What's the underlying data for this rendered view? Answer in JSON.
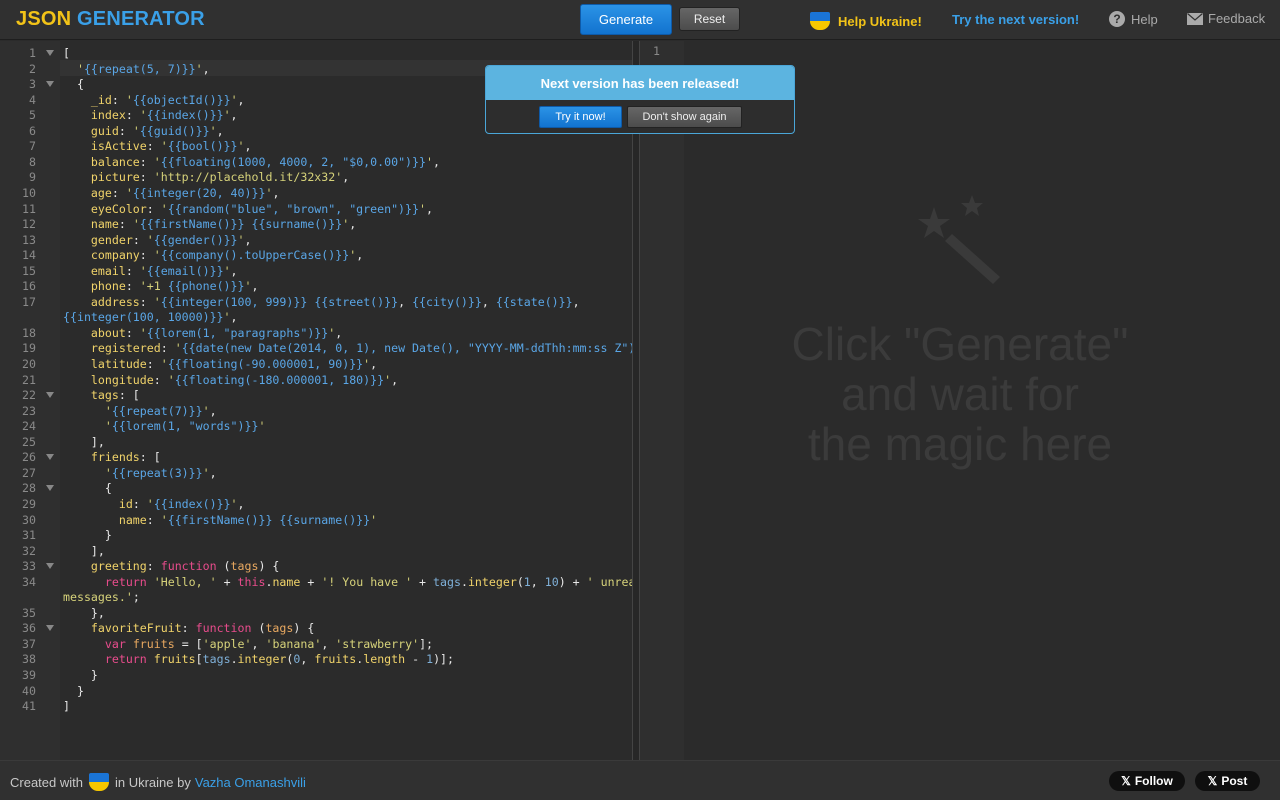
{
  "header": {
    "logo_left": "JSON ",
    "logo_right": "GENERATOR",
    "generate_label": "Generate",
    "reset_label": "Reset",
    "help_ukraine": "Help Ukraine!",
    "next_version": "Try the next version!",
    "help": "Help",
    "feedback": "Feedback"
  },
  "popup": {
    "title": "Next version has been released!",
    "try_label": "Try it now!",
    "dont_show_label": "Don't show again"
  },
  "editor": {
    "lines": [
      {
        "n": "1",
        "fold": true,
        "html": "<span class='w'>[</span>"
      },
      {
        "n": "2",
        "fold": false,
        "html": "  <span class='s'>'</span><span class='t'>{{repeat(5, 7)}}</span><span class='s'>'</span>,"
      },
      {
        "n": "3",
        "fold": true,
        "html": "  {"
      },
      {
        "n": "4",
        "fold": false,
        "html": "    <span class='k'>_id</span>: <span class='s'>'</span><span class='t'>{{objectId()}}</span><span class='s'>'</span>,"
      },
      {
        "n": "5",
        "fold": false,
        "html": "    <span class='k'>index</span>: <span class='s'>'</span><span class='t'>{{index()}}</span><span class='s'>'</span>,"
      },
      {
        "n": "6",
        "fold": false,
        "html": "    <span class='k'>guid</span>: <span class='s'>'</span><span class='t'>{{guid()}}</span><span class='s'>'</span>,"
      },
      {
        "n": "7",
        "fold": false,
        "html": "    <span class='k'>isActive</span>: <span class='s'>'</span><span class='t'>{{bool()}}</span><span class='s'>'</span>,"
      },
      {
        "n": "8",
        "fold": false,
        "html": "    <span class='k'>balance</span>: <span class='s'>'</span><span class='t'>{{floating(1000, 4000, 2, \"$0,0.00\")}}</span><span class='s'>'</span>,"
      },
      {
        "n": "9",
        "fold": false,
        "html": "    <span class='k'>picture</span>: <span class='s'>'http://placehold.it/32x32'</span>,"
      },
      {
        "n": "10",
        "fold": false,
        "html": "    <span class='k'>age</span>: <span class='s'>'</span><span class='t'>{{integer(20, 40)}}</span><span class='s'>'</span>,"
      },
      {
        "n": "11",
        "fold": false,
        "html": "    <span class='k'>eyeColor</span>: <span class='s'>'</span><span class='t'>{{random(\"blue\", \"brown\", \"green\")}}</span><span class='s'>'</span>,"
      },
      {
        "n": "12",
        "fold": false,
        "html": "    <span class='k'>name</span>: <span class='s'>'</span><span class='t'>{{firstName()}} {{surname()}}</span><span class='s'>'</span>,"
      },
      {
        "n": "13",
        "fold": false,
        "html": "    <span class='k'>gender</span>: <span class='s'>'</span><span class='t'>{{gender()}}</span><span class='s'>'</span>,"
      },
      {
        "n": "14",
        "fold": false,
        "html": "    <span class='k'>company</span>: <span class='s'>'</span><span class='t'>{{company().toUpperCase()}}</span><span class='s'>'</span>,"
      },
      {
        "n": "15",
        "fold": false,
        "html": "    <span class='k'>email</span>: <span class='s'>'</span><span class='t'>{{email()}}</span><span class='s'>'</span>,"
      },
      {
        "n": "16",
        "fold": false,
        "html": "    <span class='k'>phone</span>: <span class='s'>'+1 </span><span class='t'>{{phone()}}</span><span class='s'>'</span>,"
      },
      {
        "n": "17",
        "fold": false,
        "html": "    <span class='k'>address</span>: <span class='s'>'</span><span class='t'>{{integer(100, 999)}}</span> <span class='t'>{{street()}}</span>, <span class='t'>{{city()}}</span>, <span class='t'>{{state()}}</span>,"
      },
      {
        "n": "",
        "fold": false,
        "html": "<span class='t'>{{integer(100, 10000)}}</span><span class='s'>'</span>,"
      },
      {
        "n": "18",
        "fold": false,
        "html": "    <span class='k'>about</span>: <span class='s'>'</span><span class='t'>{{lorem(1, \"paragraphs\")}}</span><span class='s'>'</span>,"
      },
      {
        "n": "19",
        "fold": false,
        "html": "    <span class='k'>registered</span>: <span class='s'>'</span><span class='t'>{{date(new Date(2014, 0, 1), new Date(), \"YYYY-MM-ddThh:mm:ss Z\")}}</span><span class='s'>'</span>,"
      },
      {
        "n": "20",
        "fold": false,
        "html": "    <span class='k'>latitude</span>: <span class='s'>'</span><span class='t'>{{floating(-90.000001, 90)}}</span><span class='s'>'</span>,"
      },
      {
        "n": "21",
        "fold": false,
        "html": "    <span class='k'>longitude</span>: <span class='s'>'</span><span class='t'>{{floating(-180.000001, 180)}}</span><span class='s'>'</span>,"
      },
      {
        "n": "22",
        "fold": true,
        "html": "    <span class='k'>tags</span>: ["
      },
      {
        "n": "23",
        "fold": false,
        "html": "      <span class='s'>'</span><span class='t'>{{repeat(7)}}</span><span class='s'>'</span>,"
      },
      {
        "n": "24",
        "fold": false,
        "html": "      <span class='s'>'</span><span class='t'>{{lorem(1, \"words\")}}</span><span class='s'>'</span>"
      },
      {
        "n": "25",
        "fold": false,
        "html": "    ],"
      },
      {
        "n": "26",
        "fold": true,
        "html": "    <span class='k'>friends</span>: ["
      },
      {
        "n": "27",
        "fold": false,
        "html": "      <span class='s'>'</span><span class='t'>{{repeat(3)}}</span><span class='s'>'</span>,"
      },
      {
        "n": "28",
        "fold": true,
        "html": "      {"
      },
      {
        "n": "29",
        "fold": false,
        "html": "        <span class='k'>id</span>: <span class='s'>'</span><span class='t'>{{index()}}</span><span class='s'>'</span>,"
      },
      {
        "n": "30",
        "fold": false,
        "html": "        <span class='k'>name</span>: <span class='s'>'</span><span class='t'>{{firstName()}} {{surname()}}</span><span class='s'>'</span>"
      },
      {
        "n": "31",
        "fold": false,
        "html": "      }"
      },
      {
        "n": "32",
        "fold": false,
        "html": "    ],"
      },
      {
        "n": "33",
        "fold": true,
        "html": "    <span class='k'>greeting</span>: <span class='f'>function</span> (<span class='p'>tags</span>) {"
      },
      {
        "n": "34",
        "fold": false,
        "html": "      <span class='f'>return</span> <span class='st'>'Hello, '</span> + <span class='f'>this</span>.<span class='k'>name</span> + <span class='st'>'! You have '</span> + <span class='n'>tags</span>.<span class='k'>integer</span>(<span class='n'>1</span>, <span class='n'>10</span>) + <span class='st'>' unread</span>"
      },
      {
        "n": "",
        "fold": false,
        "html": "<span class='st'>messages.'</span>;"
      },
      {
        "n": "35",
        "fold": false,
        "html": "    },"
      },
      {
        "n": "36",
        "fold": true,
        "html": "    <span class='k'>favoriteFruit</span>: <span class='f'>function</span> (<span class='p'>tags</span>) {"
      },
      {
        "n": "37",
        "fold": false,
        "html": "      <span class='f'>var</span> <span class='p'>fruits</span> = [<span class='st'>'apple'</span>, <span class='st'>'banana'</span>, <span class='st'>'strawberry'</span>];"
      },
      {
        "n": "38",
        "fold": false,
        "html": "      <span class='f'>return</span> <span class='k'>fruits</span>[<span class='n'>tags</span>.<span class='k'>integer</span>(<span class='n'>0</span>, <span class='k'>fruits</span>.<span class='k'>length</span> - <span class='n'>1</span>)];"
      },
      {
        "n": "39",
        "fold": false,
        "html": "    }"
      },
      {
        "n": "40",
        "fold": false,
        "html": "  }"
      },
      {
        "n": "41",
        "fold": false,
        "html": "]"
      }
    ]
  },
  "output": {
    "line_number": "1",
    "placeholder": "Click \"Generate\"\nand wait for\nthe magic here",
    "icon": "magic-wand-icon"
  },
  "footer": {
    "created_with": "Created with",
    "in_ukraine_by": "in Ukraine by",
    "author": "Vazha Omanashvili",
    "follow_label": "Follow",
    "post_label": "Post"
  },
  "colors": {
    "accent_blue": "#3aa0e8",
    "accent_yellow": "#f2c318",
    "popup_title_bg": "#5cb4e0"
  }
}
